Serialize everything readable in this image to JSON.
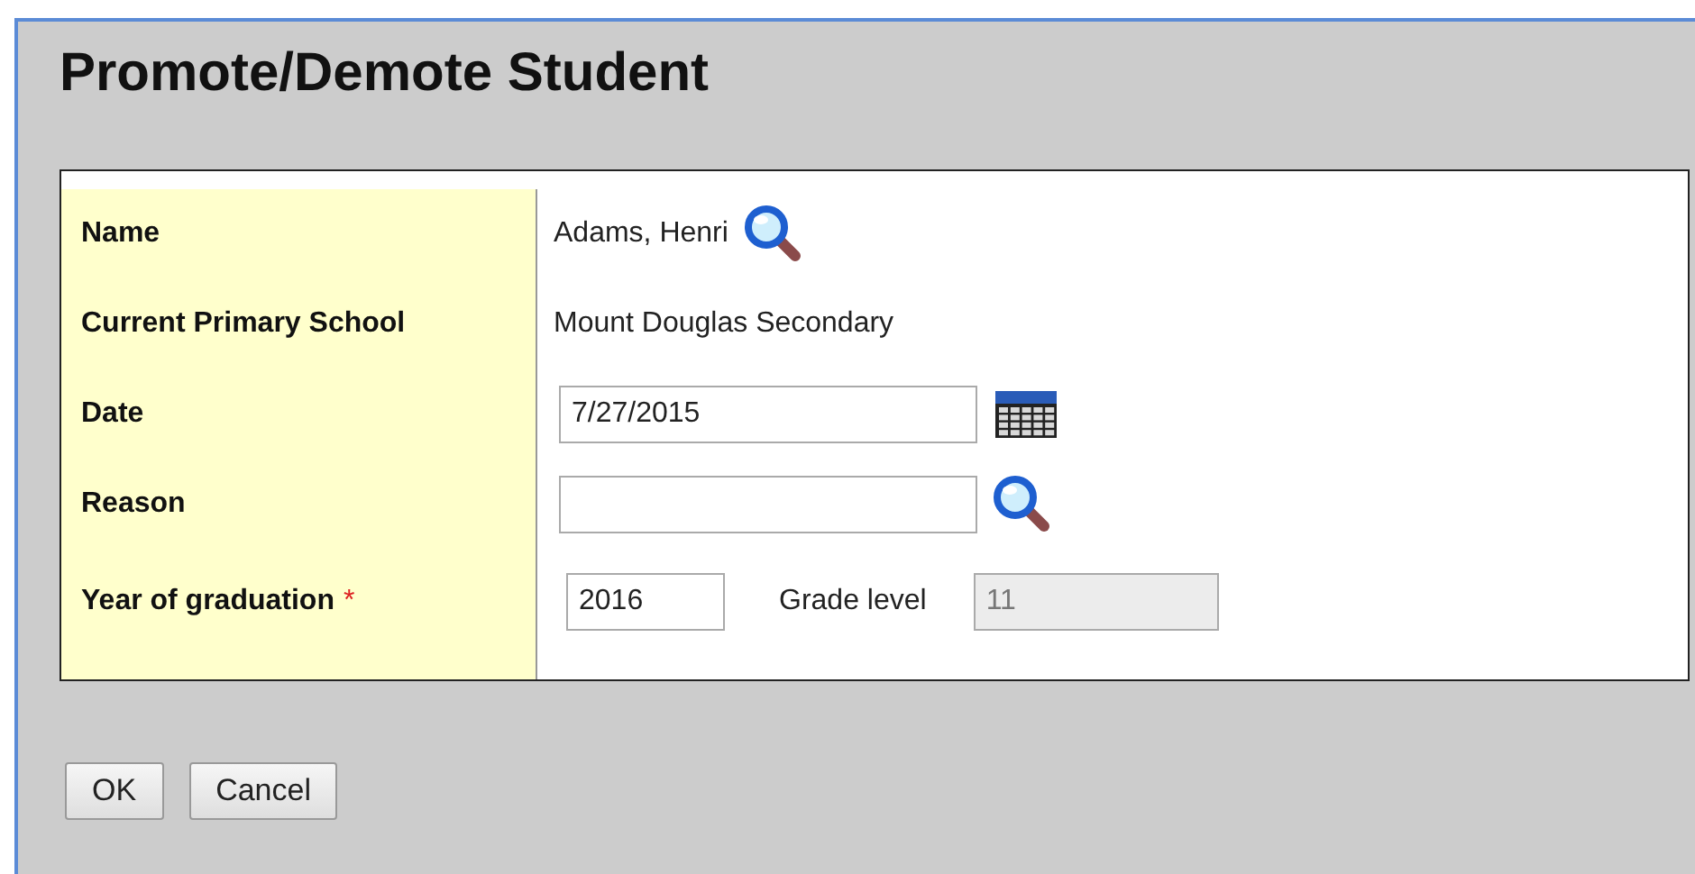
{
  "title": "Promote/Demote Student",
  "rows": [
    {
      "label": "Name",
      "kind": "text_lookup",
      "value": "Adams, Henri"
    },
    {
      "label": "Current Primary School",
      "kind": "text",
      "value": "Mount Douglas Secondary"
    },
    {
      "label": "Date",
      "kind": "date",
      "value": "7/27/2015"
    },
    {
      "label": "Reason",
      "kind": "lookup_field"
    },
    {
      "label": "Year of graduation",
      "required_mark": "*",
      "kind": "graduation",
      "value": "2016",
      "extra_label": "Grade level",
      "extra_value": "11",
      "extra_disabled": true
    }
  ],
  "buttons": [
    "OK",
    "Cancel"
  ]
}
